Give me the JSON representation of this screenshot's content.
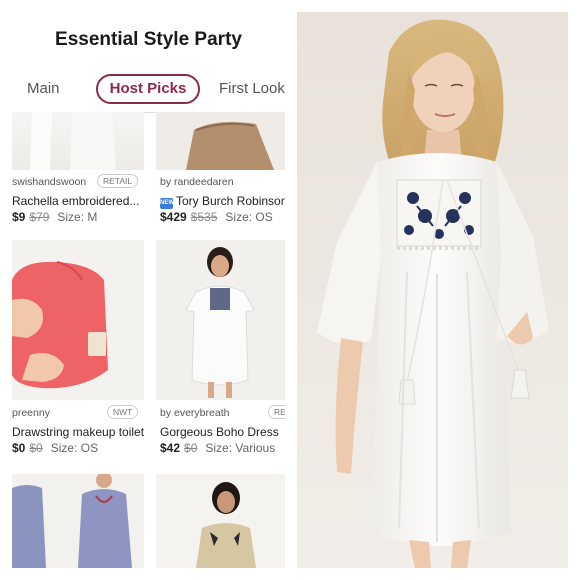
{
  "header": {
    "title": "Essential Style Party"
  },
  "tabs": [
    {
      "label": "Main"
    },
    {
      "label": "Host Picks"
    },
    {
      "label": "First Look"
    }
  ],
  "listings": [
    {
      "seller": "swishandswoon",
      "tag": "RETAIL",
      "title": "Rachella embroidered...",
      "price": "$9",
      "orig": "$79",
      "size": "Size: M"
    },
    {
      "seller": "by randeedaren",
      "tag": "",
      "title": "Tory Burch Robinson",
      "price": "$429",
      "orig": "$535",
      "size": "Size: OS",
      "badge": "NEW"
    },
    {
      "seller": "preenny",
      "tag": "NWT",
      "title": "Drawstring makeup toilet...",
      "price": "$0",
      "orig": "$0",
      "size": "Size: OS"
    },
    {
      "seller": "by everybreath",
      "tag": "RE",
      "title": "Gorgeous Boho Dress",
      "price": "$42",
      "orig": "$0",
      "size": "Size: Various"
    }
  ],
  "colors": {
    "accent": "#8a2a4e",
    "new_badge": "#3b7dd8"
  }
}
